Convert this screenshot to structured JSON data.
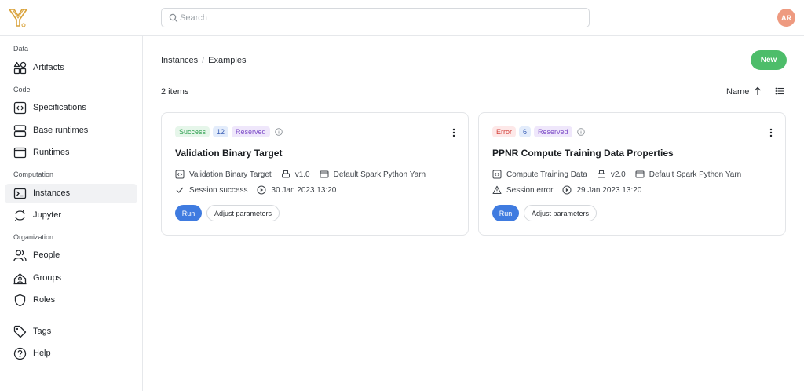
{
  "header": {
    "search": {
      "placeholder": "Search",
      "value": ""
    },
    "avatar": "AR"
  },
  "sidebar": {
    "sections": [
      {
        "label": "Data"
      },
      {
        "label": "Code"
      },
      {
        "label": "Computation"
      },
      {
        "label": "Organization"
      }
    ],
    "items": [
      {
        "label": "Artifacts",
        "icon": "shapes-icon"
      },
      {
        "label": "Specifications",
        "icon": "code-file-icon"
      },
      {
        "label": "Base runtimes",
        "icon": "server-icon"
      },
      {
        "label": "Runtimes",
        "icon": "window-icon"
      },
      {
        "label": "Instances",
        "icon": "terminal-icon",
        "active": true
      },
      {
        "label": "Jupyter",
        "icon": "jupyter-icon"
      },
      {
        "label": "People",
        "icon": "people-icon"
      },
      {
        "label": "Groups",
        "icon": "groups-icon"
      },
      {
        "label": "Roles",
        "icon": "shield-icon"
      },
      {
        "label": "Tags",
        "icon": "tag-icon"
      },
      {
        "label": "Help",
        "icon": "help-icon"
      }
    ]
  },
  "main": {
    "breadcrumb": [
      "Instances",
      "Examples"
    ],
    "new_label": "New",
    "count": "2 items",
    "sort_label": "Name",
    "cards": [
      {
        "status": "Success",
        "count_badge": "12",
        "reserved": "Reserved",
        "title": "Validation Binary Target",
        "spec": "Validation Binary Target",
        "version": "v1.0",
        "runtime": "Default Spark Python Yarn",
        "session": "Session success",
        "date": "30 Jan 2023 13:20",
        "run_label": "Run",
        "adjust_label": "Adjust parameters"
      },
      {
        "status": "Error",
        "count_badge": "6",
        "reserved": "Reserved",
        "title": "PPNR Compute Training Data Properties",
        "spec": "Compute Training Data",
        "version": "v2.0",
        "runtime": "Default Spark Python Yarn",
        "session": "Session error",
        "date": "29 Jan 2023 13:20",
        "run_label": "Run",
        "adjust_label": "Adjust parameters"
      }
    ]
  },
  "colors": {
    "accent_blue": "#3f7be0",
    "new_green": "#4dbd6a",
    "avatar": "#ee9a80",
    "logo": "#d9a23a"
  }
}
